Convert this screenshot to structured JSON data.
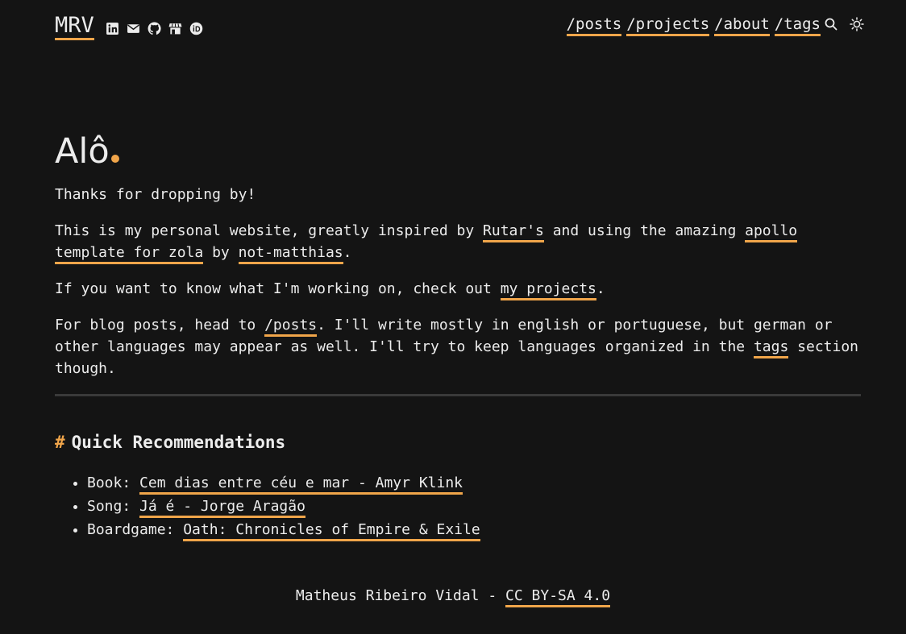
{
  "header": {
    "logo": "MRV",
    "socials": [
      {
        "icon": "linkedin-icon"
      },
      {
        "icon": "email-icon"
      },
      {
        "icon": "github-icon"
      },
      {
        "icon": "store-icon"
      },
      {
        "icon": "orcid-icon"
      }
    ],
    "nav": [
      "/posts",
      "/projects",
      "/about",
      "/tags"
    ],
    "search_icon": "search-icon",
    "theme_icon": "sun-icon"
  },
  "main": {
    "greeting": "Alô",
    "intro": "Thanks for dropping by!",
    "p2": {
      "before": "This is my personal website, greatly inspired by ",
      "link1": "Rutar's",
      "middle": " and using the amazing ",
      "link2": "apollo template for zola",
      "by": " by ",
      "link3": "not-matthias",
      "after": "."
    },
    "p3": {
      "before": "If you want to know what I'm working on, check out ",
      "link": "my projects",
      "after": "."
    },
    "p4": {
      "before": "For blog posts, head to ",
      "link1": "/posts",
      "middle": ". I'll write mostly in english or portuguese, but german or other languages may appear as well. I'll try to keep languages organized in the ",
      "link2": "tags",
      "after": " section though."
    }
  },
  "recommendations": {
    "hash": "#",
    "heading": "Quick Recommendations",
    "items": [
      {
        "label": "Book: ",
        "link": "Cem dias entre céu e mar - Amyr Klink"
      },
      {
        "label": "Song: ",
        "link": "Já é - Jorge Aragão"
      },
      {
        "label": "Boardgame: ",
        "link": "Oath: Chronicles of Empire & Exile"
      }
    ]
  },
  "footer": {
    "text": "Matheus Ribeiro Vidal - ",
    "license": "CC BY-SA 4.0"
  },
  "colors": {
    "background": "#141414",
    "text": "#ececec",
    "accent": "#f0a54a",
    "divider": "#3a3a3a"
  }
}
